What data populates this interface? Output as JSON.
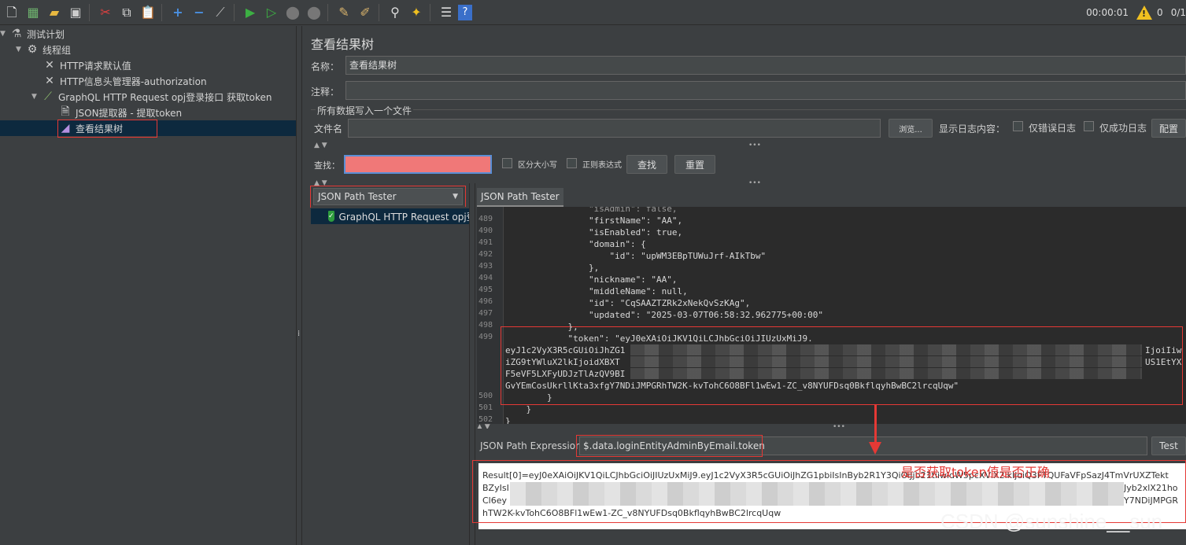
{
  "toolbar": {
    "icons": [
      "new-icon",
      "templates-icon",
      "open-icon",
      "save-icon",
      "cut-icon",
      "copy-icon",
      "paste-icon",
      "expand-icon",
      "collapse-icon",
      "toggle-icon",
      "start-icon",
      "start-no-pause-icon",
      "stop-icon",
      "shutdown-icon",
      "clear-icon",
      "clear-all-icon",
      "search-icon",
      "reset-search-icon",
      "function-helper-icon",
      "help-icon"
    ],
    "elapsed": "00:00:01",
    "warning_count": "0",
    "threads": "0/1"
  },
  "tree": {
    "items": [
      {
        "label": "测试计划",
        "icon": "test-plan-icon"
      },
      {
        "label": "线程组",
        "icon": "thread-group-icon"
      },
      {
        "label": "HTTP请求默认值",
        "icon": "config-tools-icon"
      },
      {
        "label": "HTTP信息头管理器-authorization",
        "icon": "config-tools-icon"
      },
      {
        "label": "GraphQL HTTP Request opj登录接口 获取token",
        "icon": "sampler-pen-icon"
      },
      {
        "label": "JSON提取器 - 提取token",
        "icon": "extractor-doc-icon"
      },
      {
        "label": "查看结果树",
        "icon": "result-tree-icon"
      }
    ]
  },
  "panel": {
    "title": "查看结果树",
    "name_label": "名称：",
    "name_value": "查看结果树",
    "comment_label": "注释：",
    "comment_value": "",
    "file_group": "所有数据写入一个文件",
    "filename_label": "文件名",
    "filename_value": "",
    "browse": "浏览...",
    "log_content": "显示日志内容：",
    "errors_only": "仅错误日志",
    "success_only": "仅成功日志",
    "configure": "配置"
  },
  "search": {
    "label": "查找：",
    "value": "",
    "case_sensitive": "区分大小写",
    "regex": "正则表达式",
    "find": "查找",
    "reset": "重置"
  },
  "renderer": {
    "selected": "JSON Path Tester",
    "result_item": "GraphQL HTTP Request opj登"
  },
  "tab": {
    "label": "JSON Path Tester"
  },
  "code": {
    "lines": [
      {
        "n": "489",
        "t": "                \"firstName\": \"AA\","
      },
      {
        "n": "490",
        "t": "                \"isEnabled\": true,"
      },
      {
        "n": "491",
        "t": "                \"domain\": {"
      },
      {
        "n": "492",
        "t": "                    \"id\": \"upWM3EBpTUWuJrf-AIkTbw\""
      },
      {
        "n": "493",
        "t": "                },"
      },
      {
        "n": "494",
        "t": "                \"nickname\": \"AA\","
      },
      {
        "n": "495",
        "t": "                \"middleName\": null,"
      },
      {
        "n": "496",
        "t": "                \"id\": \"CqSAAZTZRk2xNekQvSzKAg\","
      },
      {
        "n": "497",
        "t": "                \"updated\": \"2025-03-07T06:58:32.962775+00:00\""
      },
      {
        "n": "498",
        "t": "            },"
      },
      {
        "n": "499",
        "t": "            \"token\": \"eyJ0eXAiOiJKV1QiLCJhbGciOiJIUzUxMiJ9."
      }
    ],
    "wrap_lines": [
      "eyJ1c2VyX3R5cGUiOiJhZG1",
      "iZG9tYWluX2lkIjoidXBXT",
      "F5eVF5LXFyUDJzTlAzQV9BI",
      "GvYEmCosUkrllKta3xfgY7NDiJMPGRhTW2K-kvTohC6O8BFl1wEw1-ZC_v8NYUFDsq0BkflqyhBwBC2lrcqUqw\""
    ],
    "wrap_tails": [
      "IjoiIiw",
      "US1EtYX"
    ],
    "tail_lines": [
      {
        "n": "500",
        "t": "        }"
      },
      {
        "n": "501",
        "t": "    }"
      },
      {
        "n": "502",
        "t": "}"
      }
    ]
  },
  "expression": {
    "label": "JSON Path Expression",
    "value": "$.data.loginEntityAdminByEmail.token",
    "test": "Test"
  },
  "result": {
    "lines": [
      "Result[0]=eyJ0eXAiOiJKV1QiLCJhbGciOiJIUzUxMiJ9.eyJ1c2VyX3R5cGUiOiJhZG1pbiIsInByb2R1Y3QiOiJjb21tiiwidW5pcXVlX2lkIjoiQ3FTQUFaVFpSazJ4TmVrUXZTekt",
      "BZyIsI",
      "Cl6ey",
      "hTW2K-kvTohC6O8BFl1wEw1-ZC_v8NYUFDsq0BkflqyhBwBC2lrcqUqw"
    ],
    "right_fragments": [
      "Jyb2xlX21ho",
      "Y7NDiJMPGR"
    ]
  },
  "annotation": "是否获取token值是否正确",
  "watermark": "CSDN @sunshine__sun"
}
